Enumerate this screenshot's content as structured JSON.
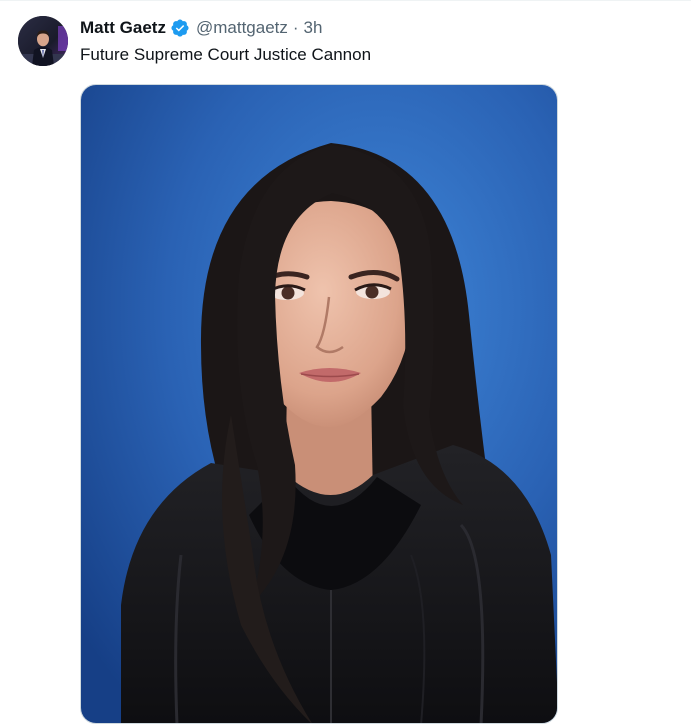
{
  "tweet": {
    "author_name": "Matt Gaetz",
    "verified": true,
    "handle": "@mattgaetz",
    "separator": "·",
    "time": "3h",
    "text": "Future Supreme Court Justice Cannon"
  },
  "icons": {
    "verified": "verified-badge-icon"
  },
  "colors": {
    "verified": "#1d9bf0",
    "secondary_text": "#536471",
    "primary_text": "#0f1419",
    "photo_background": "#2f6fc4"
  }
}
